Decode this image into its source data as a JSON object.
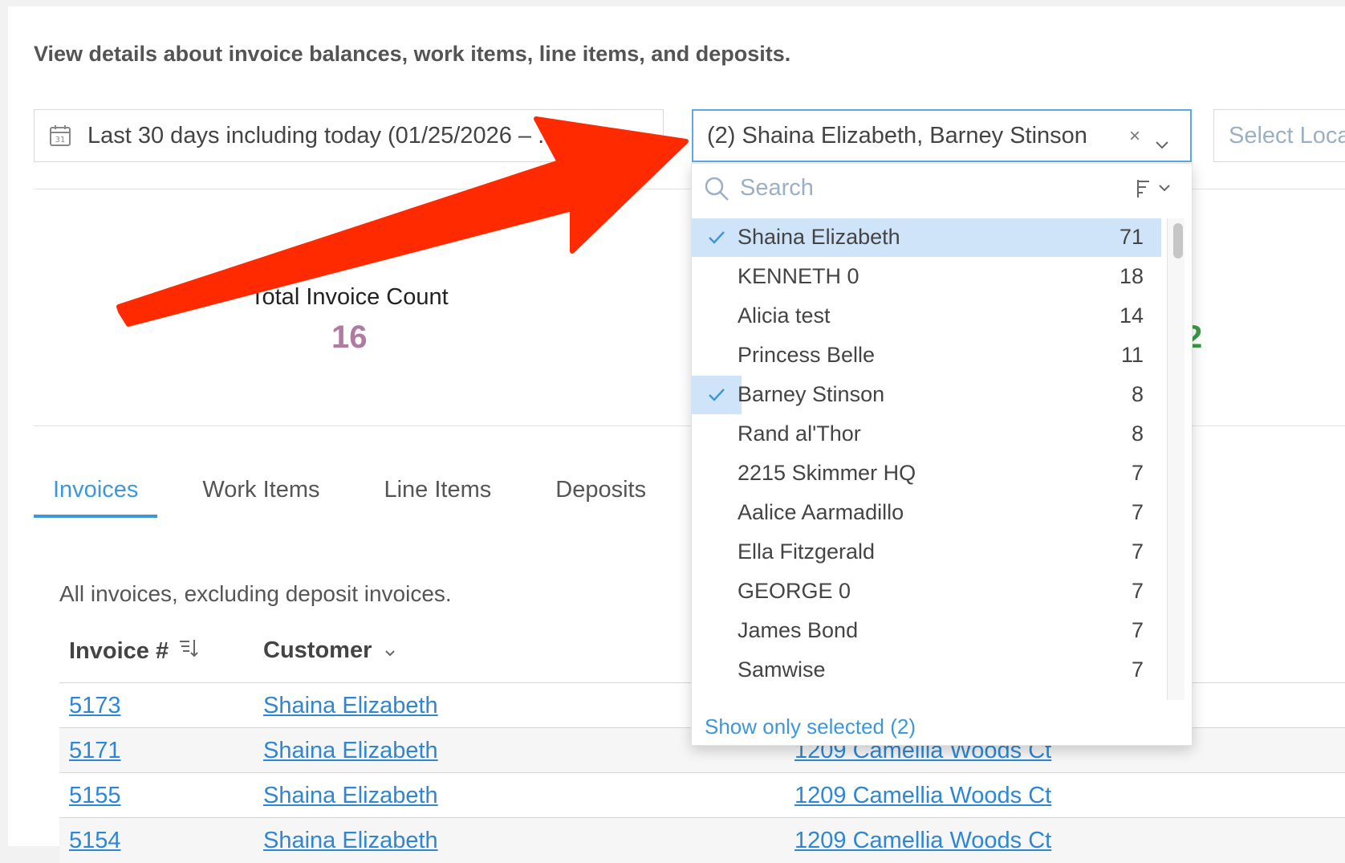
{
  "intro": "View details about invoice balances, work items, line items, and deposits.",
  "filters": {
    "date_range": "Last 30 days including today (01/25/2026 – ...",
    "users_value": "(2) Shaina Elizabeth, Barney Stinson",
    "users_clear": "×",
    "location_placeholder": "Select Loca"
  },
  "stats": {
    "count_label": "Total Invoice Count",
    "count_value": "16",
    "other_value_fragment": "2"
  },
  "tabs": [
    "Invoices",
    "Work Items",
    "Line Items",
    "Deposits"
  ],
  "subtitle": "All invoices, excluding deposit invoices.",
  "table": {
    "headers": {
      "invoice": "Invoice #",
      "customer": "Customer"
    },
    "rows": [
      {
        "invoice": "5173",
        "customer": "Shaina Elizabeth",
        "address": ""
      },
      {
        "invoice": "5171",
        "customer": "Shaina Elizabeth",
        "address": "1209 Camellia Woods Ct"
      },
      {
        "invoice": "5155",
        "customer": "Shaina Elizabeth",
        "address": "1209 Camellia Woods Ct"
      },
      {
        "invoice": "5154",
        "customer": "Shaina Elizabeth",
        "address": "1209 Camellia Woods Ct"
      }
    ]
  },
  "dropdown": {
    "search_placeholder": "Search",
    "options": [
      {
        "label": "Shaina Elizabeth",
        "count": "71",
        "selected": true
      },
      {
        "label": "KENNETH 0",
        "count": "18",
        "selected": false
      },
      {
        "label": "Alicia test",
        "count": "14",
        "selected": false
      },
      {
        "label": "Princess Belle",
        "count": "11",
        "selected": false
      },
      {
        "label": "Barney Stinson",
        "count": "8",
        "selected": true
      },
      {
        "label": "Rand al'Thor",
        "count": "8",
        "selected": false
      },
      {
        "label": "2215 Skimmer HQ",
        "count": "7",
        "selected": false
      },
      {
        "label": "Aalice Aarmadillo",
        "count": "7",
        "selected": false
      },
      {
        "label": "Ella Fitzgerald",
        "count": "7",
        "selected": false
      },
      {
        "label": "GEORGE 0",
        "count": "7",
        "selected": false
      },
      {
        "label": "James Bond",
        "count": "7",
        "selected": false
      },
      {
        "label": "Samwise",
        "count": "7",
        "selected": false
      }
    ],
    "footer": "Show only selected (2)"
  },
  "colors": {
    "accent": "#3d97d9",
    "selected_bg": "#cfe4f8",
    "count_value": "#b07aa1",
    "annotation_arrow": "#ff2a00"
  }
}
